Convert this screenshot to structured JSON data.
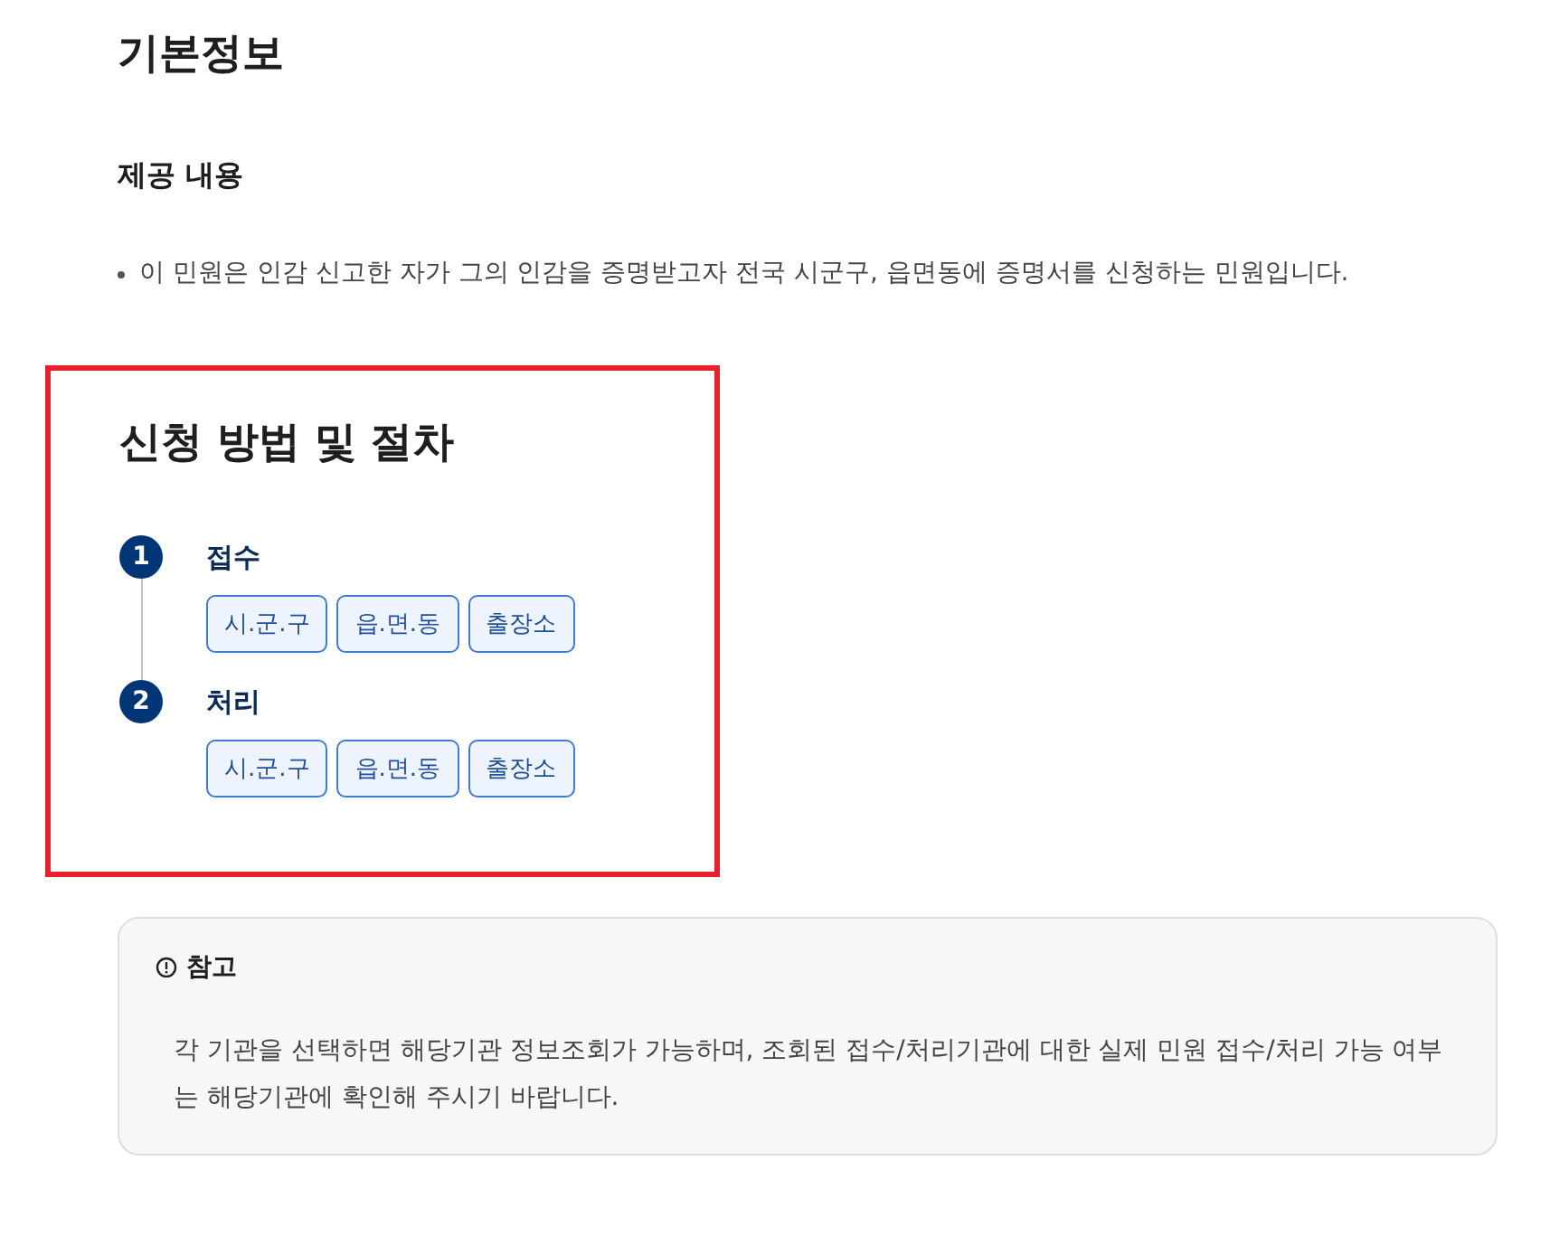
{
  "basic_info": {
    "title": "기본정보",
    "subtitle": "제공 내용",
    "bullets": [
      "이 민원은 인감 신고한 자가 그의 인감을 증명받고자 전국 시군구, 읍면동에 증명서를 신청하는 민원입니다."
    ]
  },
  "procedure": {
    "title": "신청 방법 및 절차",
    "highlighted": true,
    "steps": [
      {
        "number": "1",
        "label": "접수",
        "agencies": [
          "시.군.구",
          "읍.면.동",
          "출장소"
        ]
      },
      {
        "number": "2",
        "label": "처리",
        "agencies": [
          "시.군.구",
          "읍.면.동",
          "출장소"
        ]
      }
    ]
  },
  "note": {
    "title": "참고",
    "text": "각 기관을 선택하면 해당기관 정보조회가 가능하며, 조회된 접수/처리기관에 대한 실제 민원 접수/처리 가능 여부는 해당기관에 확인해 주시기 바랍니다."
  }
}
